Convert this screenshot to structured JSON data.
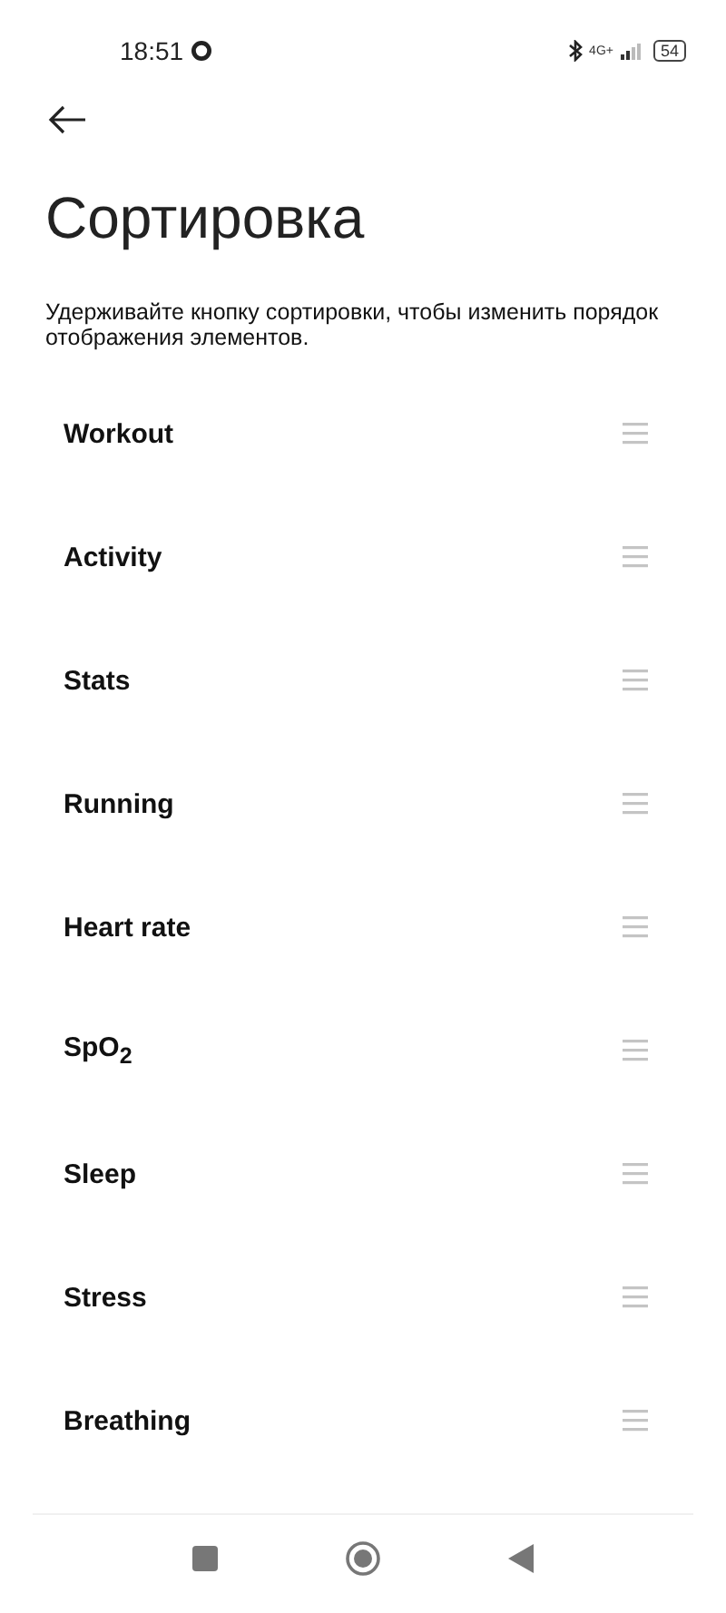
{
  "status_bar": {
    "time": "18:51",
    "network": "4G+",
    "battery": "54"
  },
  "title": "Сортировка",
  "description": "Удерживайте кнопку сортировки, чтобы изменить порядок отображения элементов.",
  "items": [
    {
      "label": "Workout"
    },
    {
      "label": "Activity"
    },
    {
      "label": "Stats"
    },
    {
      "label": "Running"
    },
    {
      "label": "Heart rate"
    },
    {
      "label": "SpO$_{2}$"
    },
    {
      "label": "Sleep"
    },
    {
      "label": "Stress"
    },
    {
      "label": "Breathing"
    }
  ]
}
